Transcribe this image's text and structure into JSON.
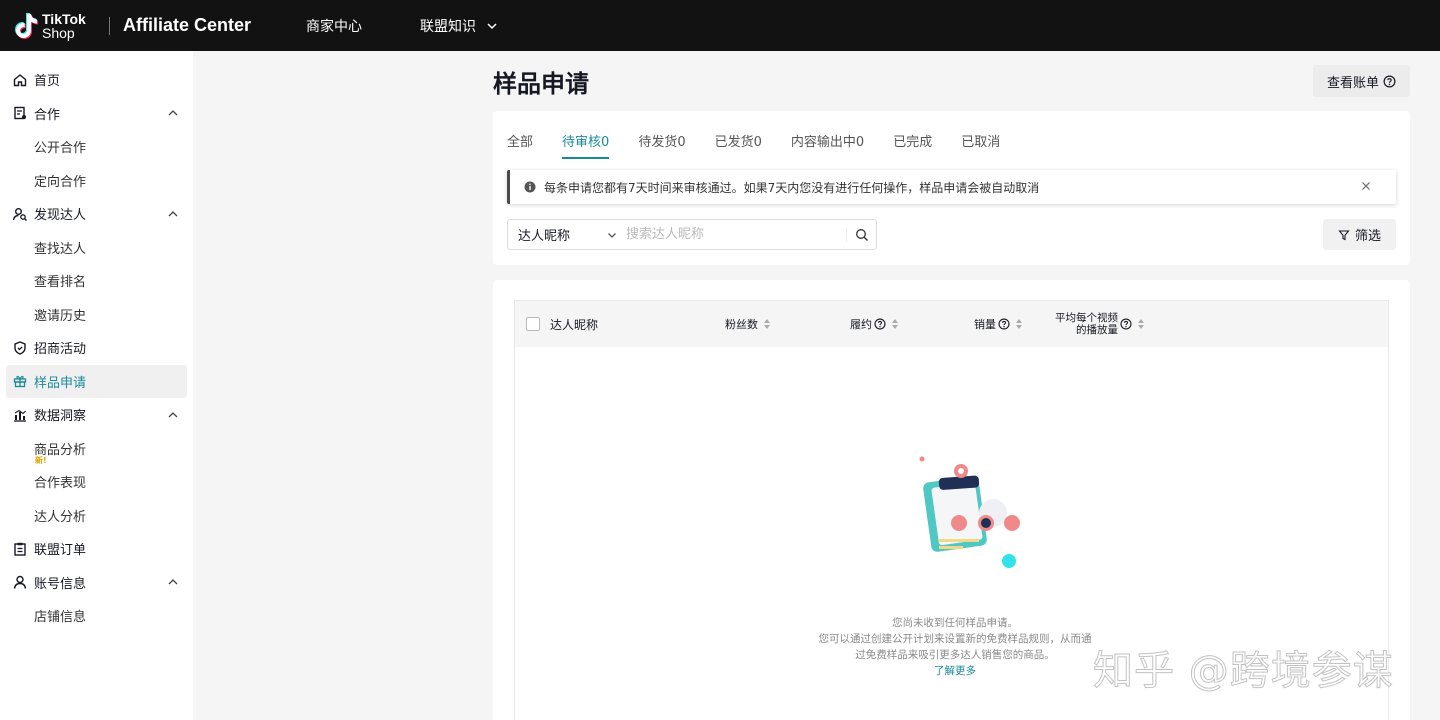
{
  "header": {
    "logo_line1": "TikTok",
    "logo_line2": "Shop",
    "brand": "Affiliate Center",
    "nav": [
      {
        "label": "商家中心"
      },
      {
        "label": "联盟知识"
      }
    ]
  },
  "sidebar": {
    "items": [
      {
        "label": "首页",
        "icon": "home-icon"
      },
      {
        "label": "合作",
        "icon": "cooperation-icon"
      },
      {
        "label": "公开合作"
      },
      {
        "label": "定向合作"
      },
      {
        "label": "发现达人",
        "icon": "find-creator-icon"
      },
      {
        "label": "查找达人"
      },
      {
        "label": "查看排名"
      },
      {
        "label": "邀请历史"
      },
      {
        "label": "招商活动",
        "icon": "shield-icon"
      },
      {
        "label": "样品申请",
        "icon": "gift-icon"
      },
      {
        "label": "数据洞察",
        "icon": "chart-icon"
      },
      {
        "label": "商品分析",
        "badge": "新!"
      },
      {
        "label": "合作表现"
      },
      {
        "label": "达人分析"
      },
      {
        "label": "联盟订单",
        "icon": "clipboard-icon"
      },
      {
        "label": "账号信息",
        "icon": "user-icon"
      },
      {
        "label": "店铺信息"
      }
    ]
  },
  "main": {
    "title": "样品申请",
    "bill_button": "查看账单",
    "tabs": [
      {
        "label": "全部",
        "count": ""
      },
      {
        "label": "待审核",
        "count": "0"
      },
      {
        "label": "待发货",
        "count": "0"
      },
      {
        "label": "已发货",
        "count": "0"
      },
      {
        "label": "内容输出中",
        "count": "0"
      },
      {
        "label": "已完成",
        "count": ""
      },
      {
        "label": "已取消",
        "count": ""
      }
    ],
    "notice": "每条申请您都有7天时间来审核通过。如果7天内您没有进行任何操作，样品申请会被自动取消",
    "search": {
      "select_value": "达人昵称",
      "placeholder": "搜索达人昵称"
    },
    "filter_button": "筛选",
    "table": {
      "columns": {
        "nickname": "达人昵称",
        "fans": "粉丝数",
        "fulfillment": "履约",
        "sales": "销量",
        "avg_views_line1": "平均每个视频",
        "avg_views_line2": "的播放量"
      }
    },
    "empty": {
      "line1": "您尚未收到任何样品申请。",
      "line2": "您可以通过创建公开计划来设置新的免费样品规则，从而通",
      "line3": "过免费样品来吸引更多达人销售您的商品。",
      "link": "了解更多"
    }
  },
  "watermark": "知乎 @跨境参谋",
  "colors": {
    "accent": "#1a8a9a",
    "topbar": "#121212"
  }
}
